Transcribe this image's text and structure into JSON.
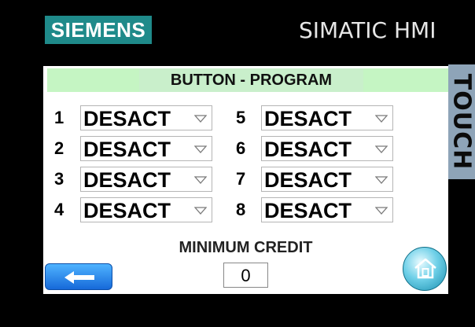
{
  "header": {
    "brand": "SIEMENS",
    "model": "SIMATIC HMI",
    "side_label": "TOUCH"
  },
  "panel": {
    "title": "BUTTON - PROGRAM",
    "buttons": [
      {
        "number": "1",
        "value": "DESACT"
      },
      {
        "number": "2",
        "value": "DESACT"
      },
      {
        "number": "3",
        "value": "DESACT"
      },
      {
        "number": "4",
        "value": "DESACT"
      },
      {
        "number": "5",
        "value": "DESACT"
      },
      {
        "number": "6",
        "value": "DESACT"
      },
      {
        "number": "7",
        "value": "DESACT"
      },
      {
        "number": "8",
        "value": "DESACT"
      }
    ],
    "minimum_credit": {
      "label": "MINIMUM CREDIT",
      "value": "0"
    }
  },
  "colors": {
    "brand_bg": "#1f8a8a",
    "title_bar": "#c5f5c3",
    "side_strip": "#8ea4b8",
    "back_button": "#2f8ef0"
  },
  "icons": {
    "back": "left-arrow-icon",
    "home": "home-icon",
    "dropdown": "chevron-down-icon"
  }
}
